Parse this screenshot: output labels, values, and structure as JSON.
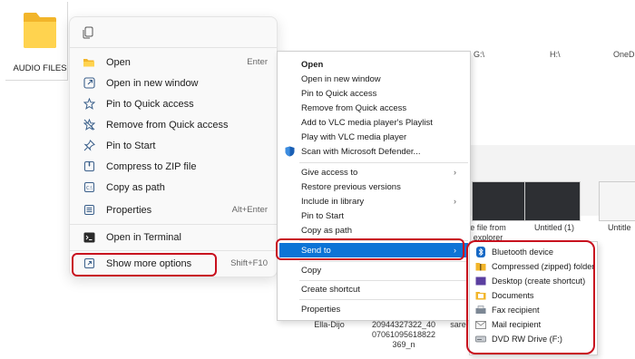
{
  "explorer": {
    "folder_label": "AUDIO FILES",
    "drive_labels": [
      "G:\\",
      "H:\\",
      "OneDi"
    ],
    "thumb_caption_1": "e file from\nexplorer",
    "thumb_caption_2": "Untitled (1)",
    "thumb_caption_3": "Untitle",
    "bottom_labels": [
      "Ella-Dijo",
      "20944327322_40\n07061095618822\n369_n",
      "sare"
    ]
  },
  "win11_menu": {
    "items": [
      {
        "label": "Open",
        "shortcut": "Enter",
        "icon": "folder-open-icon"
      },
      {
        "label": "Open in new window",
        "shortcut": "",
        "icon": "external-window-icon"
      },
      {
        "label": "Pin to Quick access",
        "shortcut": "",
        "icon": "star-icon"
      },
      {
        "label": "Remove from Quick access",
        "shortcut": "",
        "icon": "star-slash-icon"
      },
      {
        "label": "Pin to Start",
        "shortcut": "",
        "icon": "pin-icon"
      },
      {
        "label": "Compress to ZIP file",
        "shortcut": "",
        "icon": "zip-icon"
      },
      {
        "label": "Copy as path",
        "shortcut": "",
        "icon": "copy-path-icon"
      },
      {
        "label": "Properties",
        "shortcut": "Alt+Enter",
        "icon": "properties-icon"
      },
      {
        "label": "Open in Terminal",
        "shortcut": "",
        "icon": "terminal-icon"
      },
      {
        "label": "Show more options",
        "shortcut": "Shift+F10",
        "icon": "more-options-icon"
      }
    ]
  },
  "classic_menu": {
    "items": [
      {
        "label": "Open"
      },
      {
        "label": "Open in new window"
      },
      {
        "label": "Pin to Quick access"
      },
      {
        "label": "Remove from Quick access"
      },
      {
        "label": "Add to VLC media player's Playlist"
      },
      {
        "label": "Play with VLC media player"
      },
      {
        "label": "Scan with Microsoft Defender..."
      },
      {
        "label": "Give access to",
        "submenu": true
      },
      {
        "label": "Restore previous versions"
      },
      {
        "label": "Include in library",
        "submenu": true
      },
      {
        "label": "Pin to Start"
      },
      {
        "label": "Copy as path"
      },
      {
        "label": "Send to",
        "submenu": true
      },
      {
        "label": "Copy"
      },
      {
        "label": "Create shortcut"
      },
      {
        "label": "Properties"
      }
    ],
    "arrow": "›"
  },
  "sendto_menu": {
    "items": [
      {
        "label": "Bluetooth device",
        "icon": "bluetooth-icon"
      },
      {
        "label": "Compressed (zipped) folder",
        "icon": "zip-folder-icon"
      },
      {
        "label": "Desktop (create shortcut)",
        "icon": "desktop-icon"
      },
      {
        "label": "Documents",
        "icon": "documents-icon"
      },
      {
        "label": "Fax recipient",
        "icon": "fax-icon"
      },
      {
        "label": "Mail recipient",
        "icon": "mail-icon"
      },
      {
        "label": "DVD RW Drive (F:)",
        "icon": "dvd-drive-icon"
      }
    ]
  },
  "colors": {
    "highlight": "#0c74d6",
    "annotation": "#c8101e",
    "folder": "#f4c542"
  }
}
